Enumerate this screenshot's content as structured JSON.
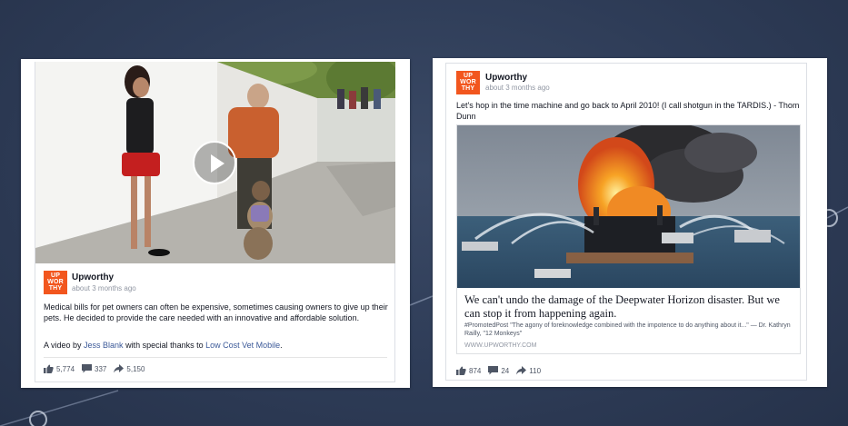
{
  "colors": {
    "brand": "#f2561e",
    "link": "#3b5998",
    "background": "#2e3c57"
  },
  "posts": [
    {
      "logo": [
        "UP",
        "WOR",
        "THY"
      ],
      "page_name": "Upworthy",
      "timestamp": "about 3 months ago",
      "text": "Medical bills for pet owners can often be expensive, sometimes causing owners to give up their pets. He decided to provide the care needed with an innovative and affordable solution.",
      "credit_prefix": "A video by ",
      "credit_name": "Jess Blank",
      "credit_mid": " with special thanks to ",
      "credit_org": "Low Cost Vet Mobile",
      "credit_end": ".",
      "likes": "5,774",
      "comments": "337",
      "shares": "5,150"
    },
    {
      "logo": [
        "UP",
        "WOR",
        "THY"
      ],
      "page_name": "Upworthy",
      "timestamp": "about 3 months ago",
      "text": "Let's hop in the time machine and go back to April 2010! (I call shotgun in the TARDIS.) - Thom Dunn",
      "link_title": "We can't undo the damage of the Deepwater Horizon disaster. But we can stop it from happening again.",
      "link_desc": "#PromotedPost \"The agony of foreknowledge combined with the impotence to do anything about it...\" — Dr. Kathryn Railly, \"12 Monkeys\"",
      "link_domain": "WWW.UPWORTHY.COM",
      "likes": "874",
      "comments": "24",
      "shares": "110"
    }
  ]
}
